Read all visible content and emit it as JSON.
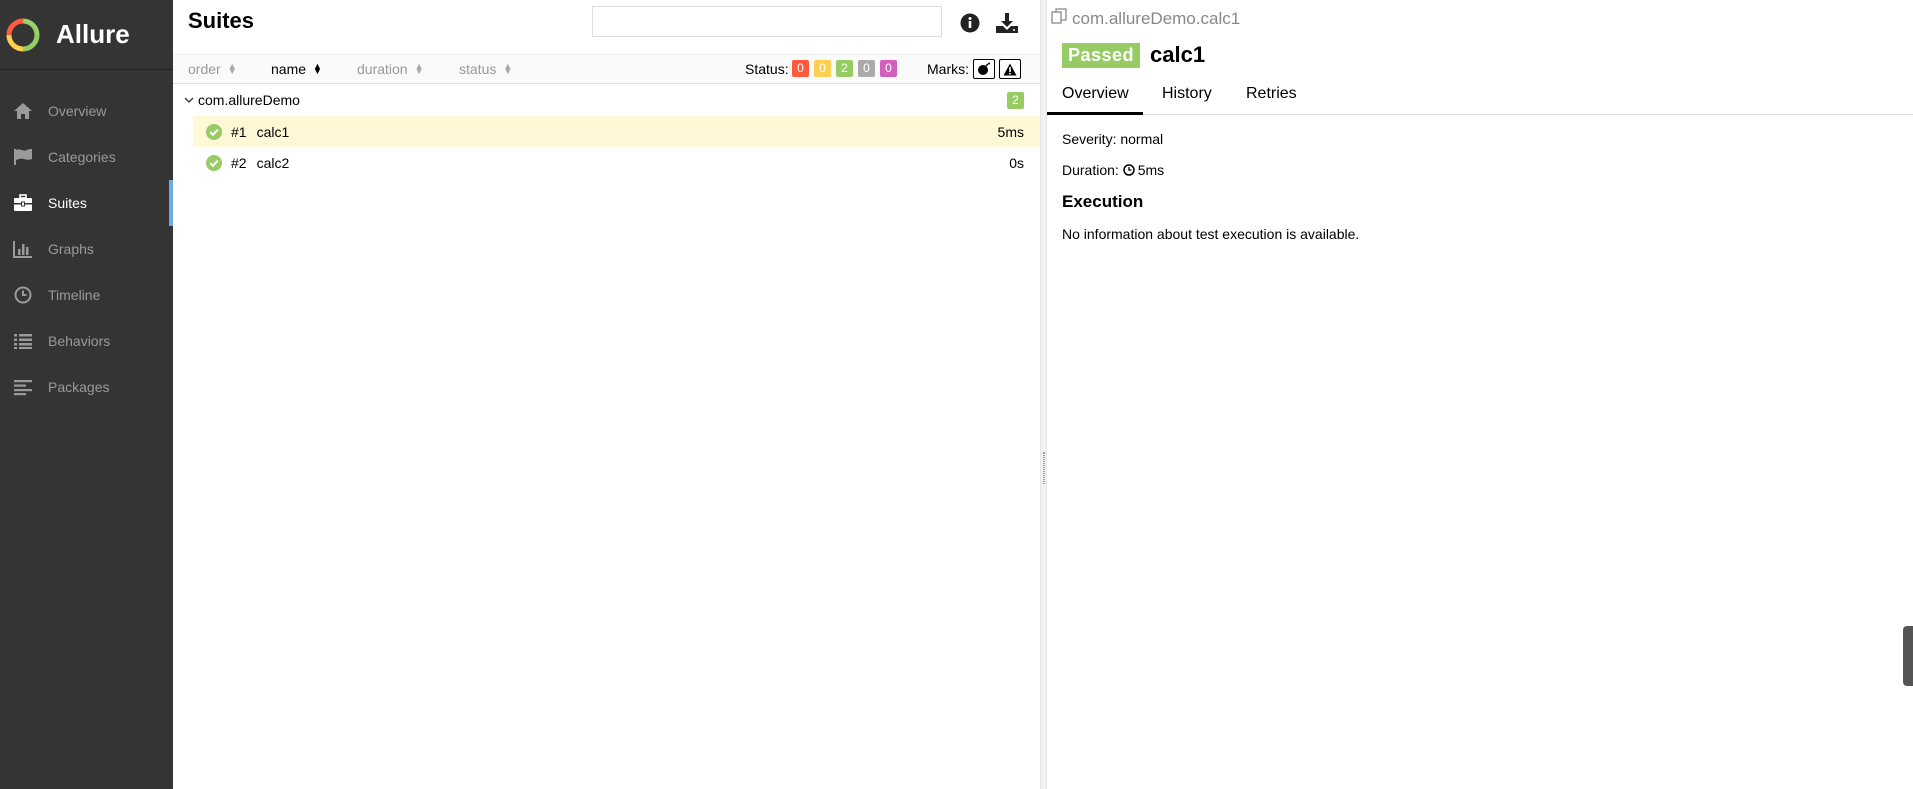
{
  "brand": {
    "name": "Allure"
  },
  "nav": {
    "items": [
      {
        "label": "Overview",
        "icon": "home-icon"
      },
      {
        "label": "Categories",
        "icon": "flag-icon"
      },
      {
        "label": "Suites",
        "icon": "briefcase-icon"
      },
      {
        "label": "Graphs",
        "icon": "bar-chart-icon"
      },
      {
        "label": "Timeline",
        "icon": "clock-icon"
      },
      {
        "label": "Behaviors",
        "icon": "list-icon"
      },
      {
        "label": "Packages",
        "icon": "align-left-icon"
      }
    ],
    "active": "Suites"
  },
  "suites": {
    "title": "Suites",
    "search_value": "",
    "sort": {
      "order": "order",
      "name": "name",
      "duration": "duration",
      "status": "status"
    },
    "status_label": "Status:",
    "status_counts": [
      {
        "value": "0",
        "color": "#fd5a3e"
      },
      {
        "value": "0",
        "color": "#ffd050"
      },
      {
        "value": "2",
        "color": "#97cc64"
      },
      {
        "value": "0",
        "color": "#aaaaaa"
      },
      {
        "value": "0",
        "color": "#d35ebe"
      }
    ],
    "marks_label": "Marks:",
    "group": {
      "name": "com.allureDemo",
      "count": "2"
    },
    "rows": [
      {
        "num": "#1",
        "name": "calc1",
        "duration": "5ms"
      },
      {
        "num": "#2",
        "name": "calc2",
        "duration": "0s"
      }
    ]
  },
  "detail": {
    "path": "com.allureDemo.calc1",
    "status": "Passed",
    "name": "calc1",
    "tabs": [
      "Overview",
      "History",
      "Retries"
    ],
    "severity": "Severity: normal",
    "duration_label": "Duration:",
    "duration_value": "5ms",
    "execution_title": "Execution",
    "execution_text": "No information about test execution is available."
  }
}
